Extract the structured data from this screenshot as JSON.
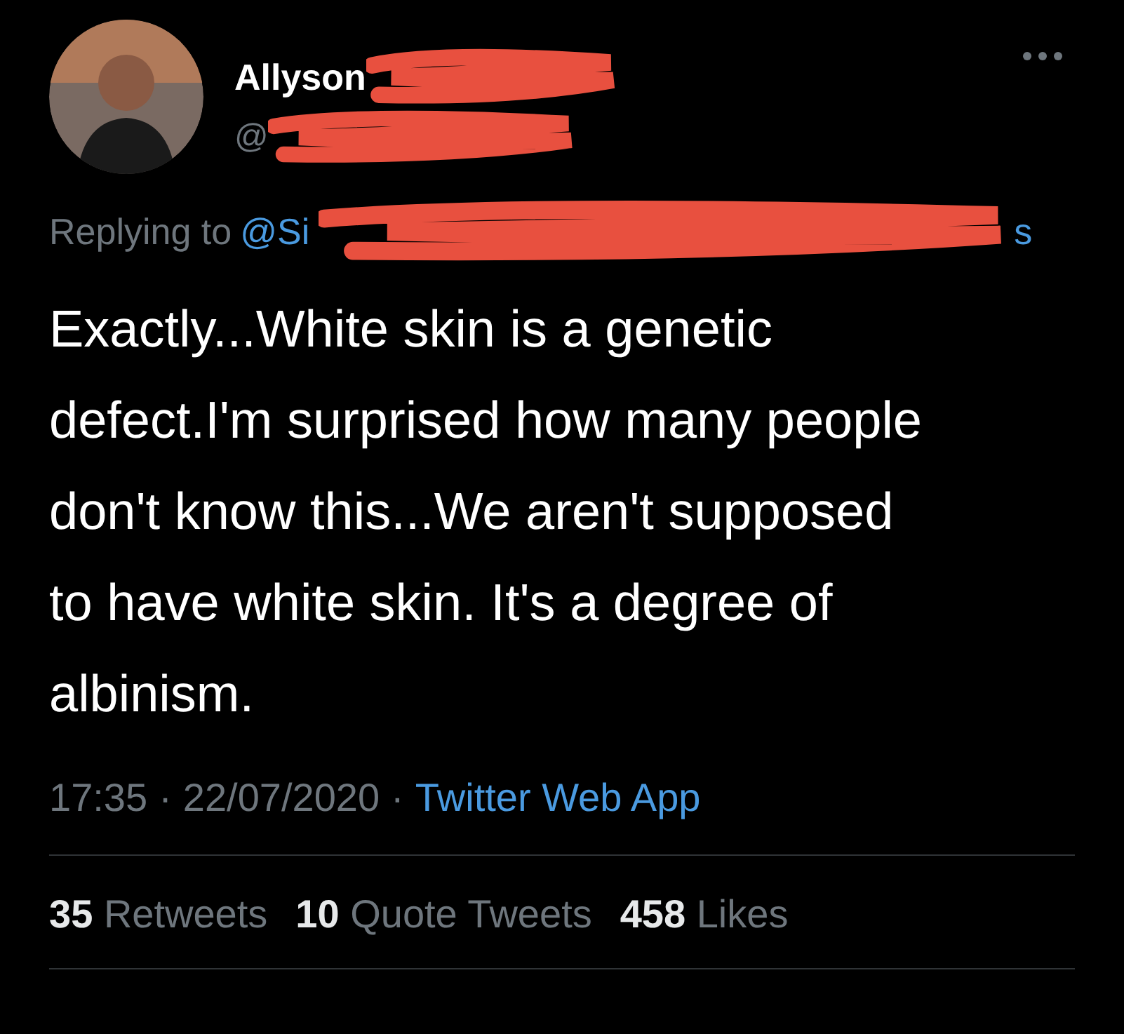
{
  "tweet": {
    "author": {
      "name": "Allyson",
      "handle": "@"
    },
    "reply_to": {
      "prefix": "Replying to",
      "mention_start": "@Si",
      "mention_end": "s"
    },
    "text": "Exactly...White skin is a genetic defect.I'm surprised how many people don't know this...We aren't supposed to have white skin. It's a degree of albinism.",
    "time": "17:35",
    "separator": "·",
    "date": "22/07/2020",
    "source": "Twitter Web App",
    "stats": [
      {
        "count": "35",
        "label": "Retweets"
      },
      {
        "count": "10",
        "label": "Quote Tweets"
      },
      {
        "count": "458",
        "label": "Likes"
      }
    ]
  }
}
